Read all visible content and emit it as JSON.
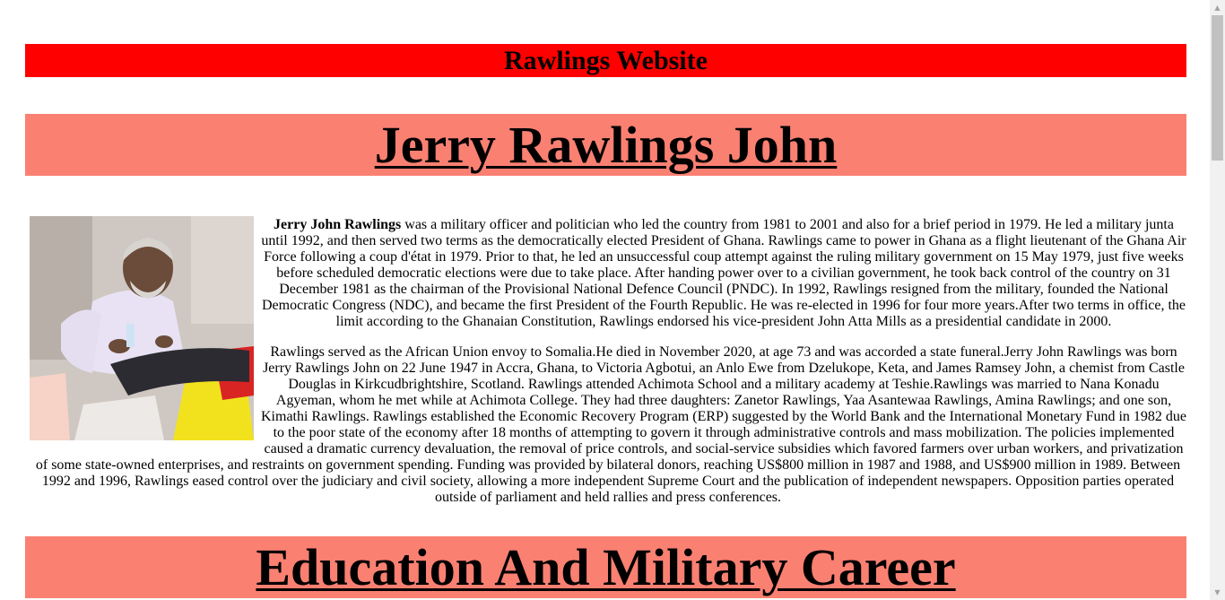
{
  "site": {
    "banner_title": "Rawlings Website"
  },
  "profile": {
    "heading": "Jerry Rawlings John",
    "name_bold": "Jerry John Rawlings",
    "intro_rest": " was a military officer and politician who led the country from 1981 to 2001 and also for a brief period in 1979. He led a military junta until 1992, and then served two terms as the democratically elected President of Ghana. Rawlings came to power in Ghana as a flight lieutenant of the Ghana Air Force following a coup d'état in 1979. Prior to that, he led an unsuccessful coup attempt against the ruling military government on 15 May 1979, just five weeks before scheduled democratic elections were due to take place. After handing power over to a civilian government, he took back control of the country on 31 December 1981 as the chairman of the Provisional National Defence Council (PNDC). In 1992, Rawlings resigned from the military, founded the National Democratic Congress (NDC), and became the first President of the Fourth Republic. He was re-elected in 1996 for four more years.After two terms in office, the limit according to the Ghanaian Constitution, Rawlings endorsed his vice-president John Atta Mills as a presidential candidate in 2000.",
    "paragraph_2": "Rawlings served as the African Union envoy to Somalia.He died in November 2020, at age 73 and was accorded a state funeral.Jerry John Rawlings was born Jerry Rawlings John on 22 June 1947 in Accra, Ghana, to Victoria Agbotui, an Anlo Ewe from Dzelukope, Keta, and James Ramsey John, a chemist from Castle Douglas in Kirkcudbrightshire, Scotland. Rawlings attended Achimota School and a military academy at Teshie.Rawlings was married to Nana Konadu Agyeman, whom he met while at Achimota College. They had three daughters: Zanetor Rawlings, Yaa Asantewaa Rawlings, Amina Rawlings; and one son, Kimathi Rawlings. Rawlings established the Economic Recovery Program (ERP) suggested by the World Bank and the International Monetary Fund in 1982 due to the poor state of the economy after 18 months of attempting to govern it through administrative controls and mass mobilization. The policies implemented caused a dramatic currency devaluation, the removal of price controls, and social-service subsidies which favored farmers over urban workers, and privatization of some state-owned enterprises, and restraints on government spending. Funding was provided by bilateral donors, reaching US$800 million in 1987 and 1988, and US$900 million in 1989. Between 1992 and 1996, Rawlings eased control over the judiciary and civil society, allowing a more independent Supreme Court and the publication of independent newspapers. Opposition parties operated outside of parliament and held rallies and press conferences."
  },
  "education": {
    "heading": "Education And Military Career"
  },
  "colors": {
    "banner": "#ff0000",
    "heading_bg": "#fa8072"
  },
  "icons": {
    "scroll_up": "arrow-up-icon",
    "scroll_down": "arrow-down-icon"
  }
}
